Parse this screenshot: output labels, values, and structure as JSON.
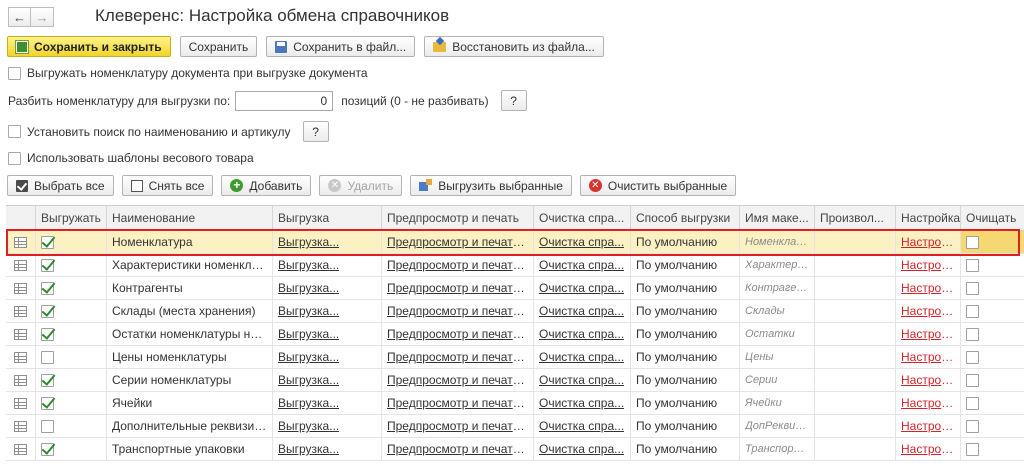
{
  "window": {
    "title": "Клеверенс: Настройка обмена справочников"
  },
  "nav": {
    "back": "←",
    "forward": "→"
  },
  "toolbar": {
    "save_close": "Сохранить и закрыть",
    "save": "Сохранить",
    "save_file": "Сохранить в файл...",
    "restore_file": "Восстановить из файла..."
  },
  "options": {
    "export_nomenclature": {
      "label": "Выгружать номенклатуру документа при выгрузке документа",
      "checked": false
    },
    "split": {
      "label": "Разбить номенклатуру для выгрузки по:",
      "value": "0",
      "suffix": "позиций (0 - не разбивать)",
      "help": "?"
    },
    "search_by_name": {
      "label": "Установить поиск по наименованию и артикулу",
      "checked": false,
      "help": "?"
    },
    "weight_templates": {
      "label": "Использовать шаблоны весового товара",
      "checked": false
    }
  },
  "table_toolbar": {
    "select_all": "Выбрать все",
    "deselect_all": "Снять все",
    "add": "Добавить",
    "delete": "Удалить",
    "export_selected": "Выгрузить выбранные",
    "clear_selected": "Очистить выбранные"
  },
  "table": {
    "columns": [
      "",
      "Выгружать",
      "Наименование",
      "Выгрузка",
      "Предпросмотр и печать",
      "Очистка спра...",
      "Способ выгрузки",
      "Имя маке...",
      "Произвол...",
      "Настройка",
      "Очищать"
    ],
    "rows": [
      {
        "export": true,
        "name": "Номенклатура",
        "unload": "Выгрузка...",
        "preview": "Предпросмотр и печать...",
        "clean": "Очистка спра...",
        "method": "По умолчанию",
        "layout": "Номенклату...",
        "setup": "Настроить",
        "clear": false
      },
      {
        "export": true,
        "name": "Характеристики номенклат...",
        "unload": "Выгрузка...",
        "preview": "Предпросмотр и печать...",
        "clean": "Очистка спра...",
        "method": "По умолчанию",
        "layout": "Характерис...",
        "setup": "Настроить",
        "clear": false
      },
      {
        "export": true,
        "name": "Контрагенты",
        "unload": "Выгрузка...",
        "preview": "Предпросмотр и печать...",
        "clean": "Очистка спра...",
        "method": "По умолчанию",
        "layout": "Контрагенты",
        "setup": "Настроить",
        "clear": false
      },
      {
        "export": true,
        "name": "Склады (места хранения)",
        "unload": "Выгрузка...",
        "preview": "Предпросмотр и печать...",
        "clean": "Очистка спра...",
        "method": "По умолчанию",
        "layout": "Склады",
        "setup": "Настроить",
        "clear": false
      },
      {
        "export": true,
        "name": "Остатки номенклатуры на ...",
        "unload": "Выгрузка...",
        "preview": "Предпросмотр и печать...",
        "clean": "Очистка спра...",
        "method": "По умолчанию",
        "layout": "Остатки",
        "setup": "Настроить",
        "clear": false
      },
      {
        "export": false,
        "name": "Цены номенклатуры",
        "unload": "Выгрузка...",
        "preview": "Предпросмотр и печать...",
        "clean": "Очистка спра...",
        "method": "По умолчанию",
        "layout": "Цены",
        "setup": "Настроить",
        "clear": false
      },
      {
        "export": true,
        "name": "Серии номенклатуры",
        "unload": "Выгрузка...",
        "preview": "Предпросмотр и печать...",
        "clean": "Очистка спра...",
        "method": "По умолчанию",
        "layout": "Серии",
        "setup": "Настроить",
        "clear": false
      },
      {
        "export": true,
        "name": "Ячейки",
        "unload": "Выгрузка...",
        "preview": "Предпросмотр и печать...",
        "clean": "Очистка спра...",
        "method": "По умолчанию",
        "layout": "Ячейки",
        "setup": "Настроить",
        "clear": false
      },
      {
        "export": false,
        "name": "Дополнительные реквизиты",
        "unload": "Выгрузка...",
        "preview": "Предпросмотр и печать...",
        "clean": "Очистка спра...",
        "method": "По умолчанию",
        "layout": "ДопРеквизи...",
        "setup": "Настроить",
        "clear": false
      },
      {
        "export": true,
        "name": "Транспортные упаковки",
        "unload": "Выгрузка...",
        "preview": "Предпросмотр и печать...",
        "clean": "Очистка спра...",
        "method": "По умолчанию",
        "layout": "Транспортн...",
        "setup": "Настроить",
        "clear": false
      }
    ]
  },
  "colors": {
    "primary_button": "#f0d529",
    "selected_row": "#fbf1c2",
    "link_red": "#d2242a",
    "highlight_frame": "#e02020"
  }
}
